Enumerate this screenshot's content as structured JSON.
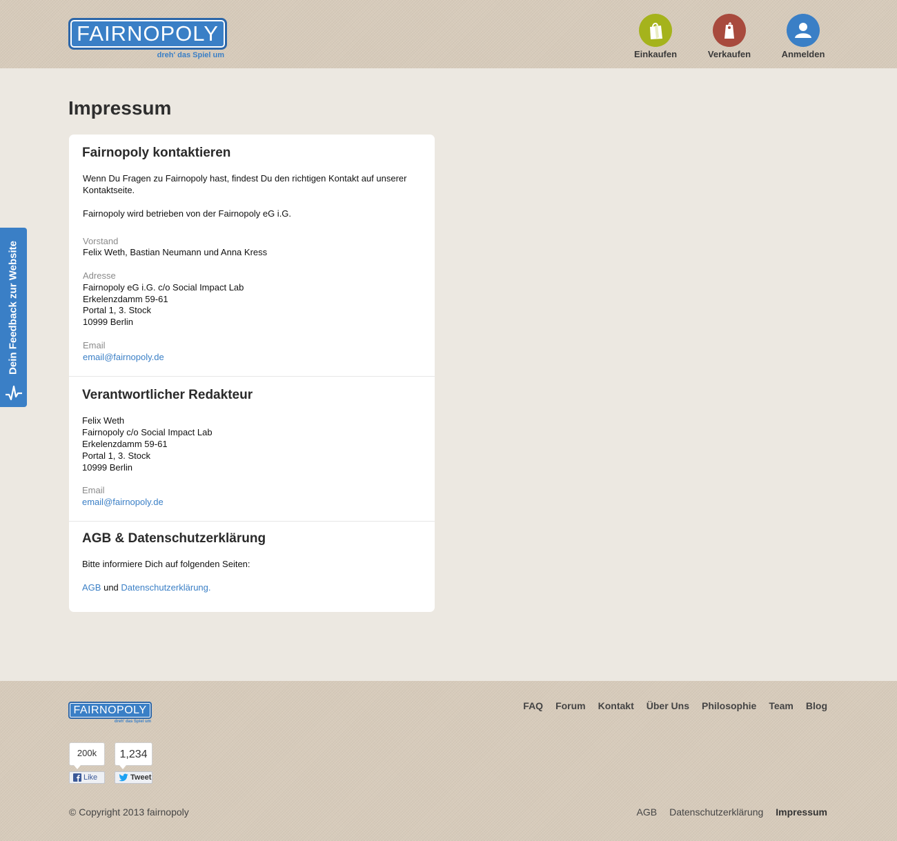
{
  "header": {
    "logo_text": "FAIRNOPOLY",
    "logo_tagline": "dreh' das Spiel um",
    "nav": [
      {
        "label": "Einkaufen",
        "icon": "shopping-bag-icon",
        "color": "#a5b31c"
      },
      {
        "label": "Verkaufen",
        "icon": "price-tag-icon",
        "color": "#a84a3d"
      },
      {
        "label": "Anmelden",
        "icon": "user-icon",
        "color": "#3a7fc6"
      }
    ]
  },
  "page_title": "Impressum",
  "contact": {
    "title": "Fairnopoly kontaktieren",
    "intro_line1": "Wenn Du Fragen zu Fairnopoly hast, findest Du den richtigen Kontakt auf unserer",
    "intro_line2": "Kontaktseite.",
    "operator": "Fairnopoly wird betrieben von der Fairnopoly eG i.G.",
    "board_label": "Vorstand",
    "board": "Felix Weth, Bastian Neumann und Anna Kress",
    "address_label": "Adresse",
    "address": [
      "Fairnopoly eG i.G. c/o Social Impact Lab",
      "Erkelenzdamm 59-61",
      "Portal 1, 3. Stock",
      "10999 Berlin"
    ],
    "email_label": "Email",
    "email": "email@fairnopoly.de"
  },
  "editor": {
    "title": "Verantwortlicher Redakteur",
    "lines": [
      "Felix Weth",
      "Fairnopoly c/o Social Impact Lab",
      "Erkelenzdamm 59-61",
      "Portal 1, 3. Stock",
      "10999 Berlin"
    ],
    "email_label": "Email",
    "email": "email@fairnopoly.de"
  },
  "terms": {
    "title": "AGB & Datenschutzerklärung",
    "text": "Bitte informiere Dich auf folgenden Seiten:",
    "agb_link": "AGB",
    "and": "und",
    "privacy_link": "Datenschutzerklärung",
    "period": "."
  },
  "feedback_tab": {
    "label": "Dein Feedback zur Website",
    "icon": "pulse-icon"
  },
  "footer": {
    "logo_text": "FAIRNOPOLY",
    "logo_tagline": "dreh' das Spiel um",
    "links": [
      "FAQ",
      "Forum",
      "Kontakt",
      "Über Uns",
      "Philosophie",
      "Team",
      "Blog"
    ],
    "like_count": "200k",
    "like_label": "Like",
    "tweet_count": "1,234",
    "tweet_label": "Tweet",
    "copyright": "© Copyright 2013 fairnopoly",
    "legal_links": [
      "AGB",
      "Datenschutzerklärung",
      "Impressum"
    ],
    "colors": {
      "accent": "#3a7fc6",
      "facebook": "#3b5998",
      "twitter": "#1da1f2"
    }
  }
}
